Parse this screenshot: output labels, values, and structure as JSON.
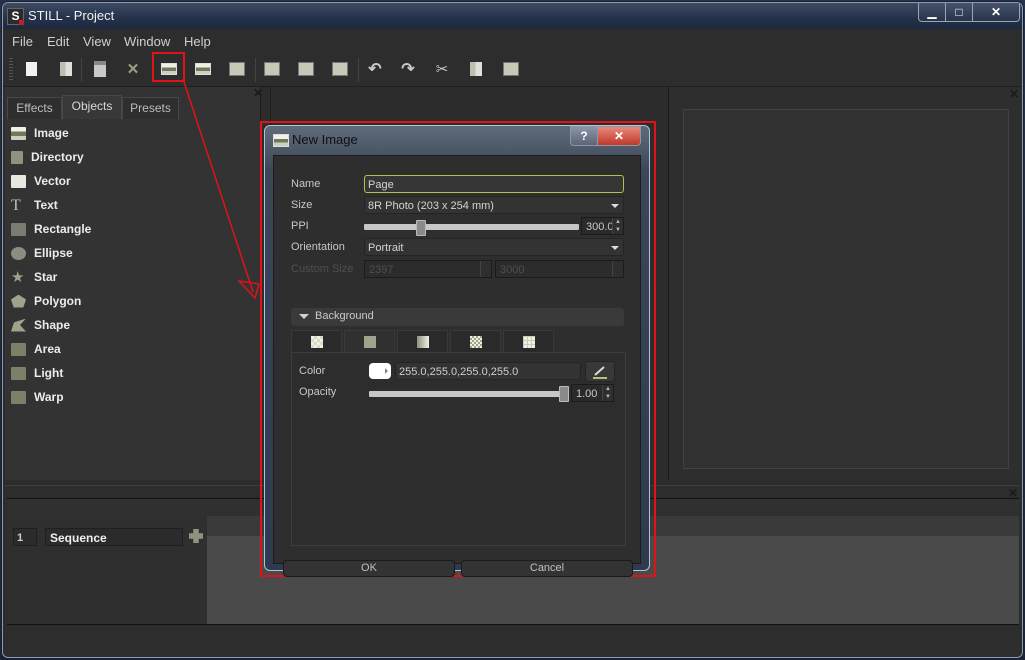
{
  "window": {
    "title": "STILL - Project",
    "logo_letter": "S",
    "controls": {
      "minimize": "▁",
      "maximize": "□",
      "close": "✕"
    }
  },
  "menu": [
    "File",
    "Edit",
    "View",
    "Window",
    "Help"
  ],
  "toolbar": {
    "buttons": [
      {
        "name": "new-document",
        "icon": "new-document-icon"
      },
      {
        "name": "open-documents",
        "icon": "documents-icon"
      },
      {
        "name": "save",
        "icon": "save-icon"
      },
      {
        "name": "close",
        "icon": "close-x-icon"
      },
      {
        "name": "new-image",
        "icon": "new-image-icon",
        "highlighted": true
      },
      {
        "name": "import-image",
        "icon": "import-image-icon"
      },
      {
        "name": "import-folder",
        "icon": "import-folder-icon"
      },
      {
        "name": "layers",
        "icon": "layers-icon"
      },
      {
        "name": "export-pdf",
        "icon": "export-pdf-icon"
      },
      {
        "name": "print",
        "icon": "print-icon"
      },
      {
        "name": "undo",
        "icon": "undo-icon"
      },
      {
        "name": "redo",
        "icon": "redo-icon"
      },
      {
        "name": "cut",
        "icon": "cut-icon"
      },
      {
        "name": "copy",
        "icon": "copy-icon"
      },
      {
        "name": "paste",
        "icon": "paste-icon"
      }
    ]
  },
  "left_panel": {
    "tabs": [
      {
        "label": "Effects",
        "active": false
      },
      {
        "label": "Objects",
        "active": true
      },
      {
        "label": "Presets",
        "active": false
      }
    ],
    "items": [
      {
        "label": "Image",
        "icon": "image-icon"
      },
      {
        "label": "Directory",
        "icon": "directory-icon"
      },
      {
        "label": "Vector",
        "icon": "svg-vector-icon"
      },
      {
        "label": "Text",
        "icon": "text-icon"
      },
      {
        "label": "Rectangle",
        "icon": "rectangle-icon"
      },
      {
        "label": "Ellipse",
        "icon": "ellipse-icon"
      },
      {
        "label": "Star",
        "icon": "star-icon"
      },
      {
        "label": "Polygon",
        "icon": "polygon-icon"
      },
      {
        "label": "Shape",
        "icon": "shape-icon"
      },
      {
        "label": "Area",
        "icon": "area-icon"
      },
      {
        "label": "Light",
        "icon": "light-icon"
      },
      {
        "label": "Warp",
        "icon": "warp-icon"
      }
    ]
  },
  "sequence": {
    "number": "1",
    "name": "Sequence"
  },
  "dialog": {
    "title": "New Image",
    "help_label": "?",
    "close_label": "✕",
    "fields": {
      "name_label": "Name",
      "name_value": "Page",
      "size_label": "Size",
      "size_value": "8R Photo (203 x 254 mm)",
      "ppi_label": "PPI",
      "ppi_value": "300.0",
      "ppi_slider_fraction": 0.25,
      "orientation_label": "Orientation",
      "orientation_value": "Portrait",
      "custom_size_label": "Custom Size",
      "custom_width": "2397",
      "custom_height": "3000"
    },
    "background": {
      "section_label": "Background",
      "tabs": [
        {
          "name": "none",
          "active": false
        },
        {
          "name": "solid-color",
          "active": true
        },
        {
          "name": "gradient",
          "active": false
        },
        {
          "name": "checker",
          "active": false
        },
        {
          "name": "grid",
          "active": false
        }
      ],
      "color_label": "Color",
      "color_value": "255.0,255.0,255.0,255.0",
      "color_hex": "#ffffff",
      "opacity_label": "Opacity",
      "opacity_value": "1.00",
      "opacity_fraction": 1.0
    },
    "ok_label": "OK",
    "cancel_label": "Cancel"
  },
  "annotation": {
    "highlight_color": "#e0121a"
  }
}
